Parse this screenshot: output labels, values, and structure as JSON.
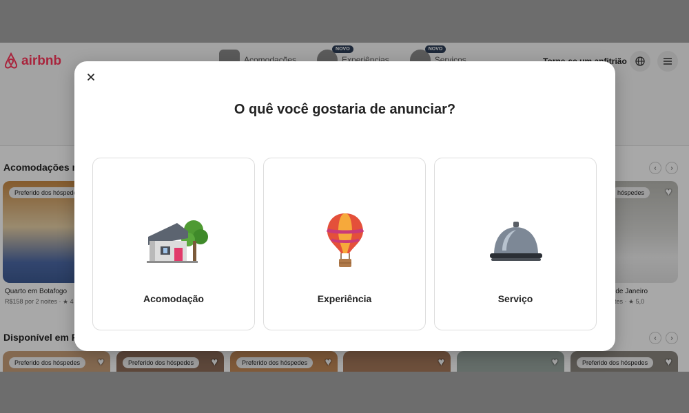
{
  "header": {
    "logo_text": "airbnb",
    "nav": [
      {
        "label": "Acomodações",
        "badge": ""
      },
      {
        "label": "Experiências",
        "badge": "NOVO"
      },
      {
        "label": "Serviços",
        "badge": "NOVO"
      }
    ],
    "host_link": "Torne-se um anfitrião",
    "globe_icon": "globe-icon",
    "menu_icon": "menu-icon"
  },
  "sections": [
    {
      "title": "Acomodações m",
      "cards": [
        {
          "badge": "Preferido dos hóspedes",
          "caption": "Quarto em Botafogo",
          "sub": "R$158 por 2 noites · ★ 4"
        },
        {
          "badge": "hóspedes",
          "caption": "o de Janeiro",
          "sub": "oites · ★ 5,0"
        }
      ]
    },
    {
      "title": "Disponível em P",
      "cards": [
        {
          "badge": "Preferido dos hóspedes"
        },
        {
          "badge": "Preferido dos hóspedes"
        },
        {
          "badge": "Preferido dos hóspedes"
        },
        {
          "badge": ""
        },
        {
          "badge": ""
        },
        {
          "badge": "Preferido dos hóspedes"
        }
      ]
    }
  ],
  "modal": {
    "close_icon": "close-icon",
    "title": "O quê você gostaria de anunciar?",
    "options": [
      {
        "label": "Acomodação",
        "icon": "house-icon"
      },
      {
        "label": "Experiência",
        "icon": "hot-air-balloon-icon"
      },
      {
        "label": "Serviço",
        "icon": "service-bell-icon"
      }
    ]
  },
  "colors": {
    "brand": "#ff385c",
    "overlay": "rgba(0,0,0,0.34)",
    "border": "#dddddd"
  }
}
